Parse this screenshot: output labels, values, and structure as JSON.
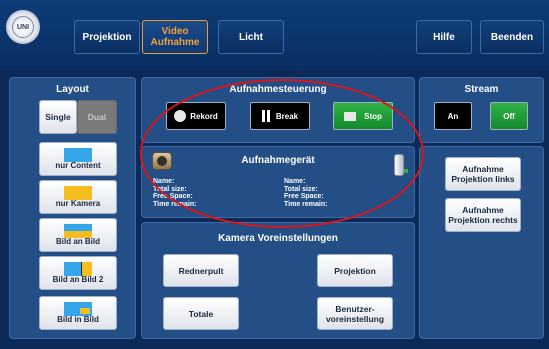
{
  "topbar": {
    "logo_text": "UNI",
    "projektion_label": "Projektion",
    "video_line1": "Video",
    "video_line2": "Aufnahme",
    "licht_label": "Licht",
    "hilfe_label": "Hilfe",
    "beenden_label": "Beenden",
    "active_color": "#f3a23a"
  },
  "layout": {
    "title": "Layout",
    "single_label": "Single",
    "dual_label": "Dual",
    "items": [
      {
        "label": "nur Content"
      },
      {
        "label": "nur Kamera"
      },
      {
        "label": "Bild an Bild"
      },
      {
        "label": "Bild an Bild 2"
      },
      {
        "label": "Bild in Bild"
      }
    ]
  },
  "aufnahme": {
    "title": "Aufnahmesteuerung",
    "rekord_label": "Rekord",
    "break_label": "Break",
    "stop_label": "Stop"
  },
  "geraet": {
    "title": "Aufnahmegerät",
    "left": {
      "name": "Name:",
      "total": "Total size:",
      "free": "Free Space:",
      "time": "Time remain:"
    },
    "right": {
      "name": "Name:",
      "total": "Total size:",
      "free": "Free Space:",
      "time": "Time remain:"
    }
  },
  "kamera": {
    "title": "Kamera Voreinstellungen",
    "rednerpult_label": "Rednerpult",
    "projektion_label": "Projektion",
    "totale_label": "Totale",
    "benutzer_line1": "Benutzer-",
    "benutzer_line2": "voreinstellung"
  },
  "stream": {
    "title": "Stream",
    "an_label": "An",
    "off_label": "Off"
  },
  "aufnahme_projektion": {
    "links_line1": "Aufnahme",
    "links_line2": "Projektion links",
    "rechts_line1": "Aufnahme",
    "rechts_line2": "Projektion rechts"
  },
  "colors": {
    "background": "#0b2a57",
    "panel": "#234e86",
    "highlight_ellipse": "#d7171c",
    "green": "#2fb344",
    "swatch_blue": "#35a7e8",
    "swatch_yellow": "#f5bd1f"
  }
}
